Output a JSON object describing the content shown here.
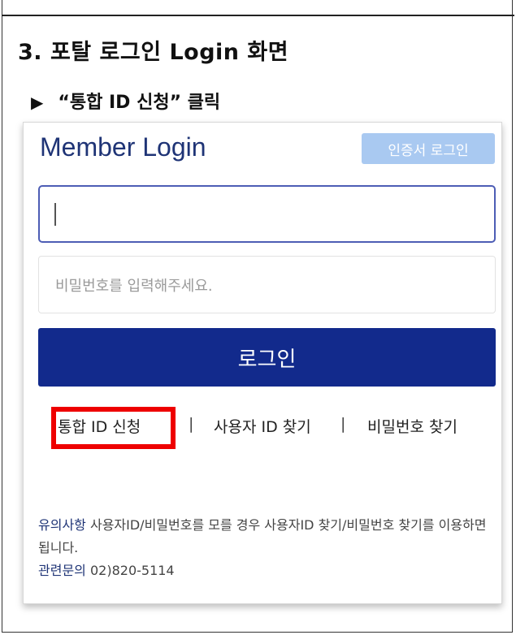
{
  "section_title": "3. 포탈 로그인 Login 화면",
  "step": {
    "arrow": "▶",
    "text": "“통합 ID 신청” 클릭"
  },
  "panel": {
    "title": "Member Login",
    "cert_button": "인증서 로그인",
    "id_input": {
      "value": "",
      "placeholder": ""
    },
    "password_input": {
      "placeholder": "비밀번호를 입력해주세요."
    },
    "login_button": "로그인",
    "links": {
      "register": "통합 ID 신청",
      "separator": "|",
      "find_id": "사용자 ID 찾기",
      "find_password": "비밀번호 찾기"
    },
    "notice": {
      "label": "유의사항",
      "text": " 사용자ID/비밀번호를 모를 경우 사용자ID 찾기/비밀번호 찾기를 이용하면 됩니다.",
      "contact_label": "관련문의",
      "contact_value": " 02)820-5114"
    }
  },
  "colors": {
    "title_blue": "#1f3476",
    "login_button": "#122a8c",
    "cert_button": "#a9c9f1",
    "highlight": "#ee0000"
  }
}
